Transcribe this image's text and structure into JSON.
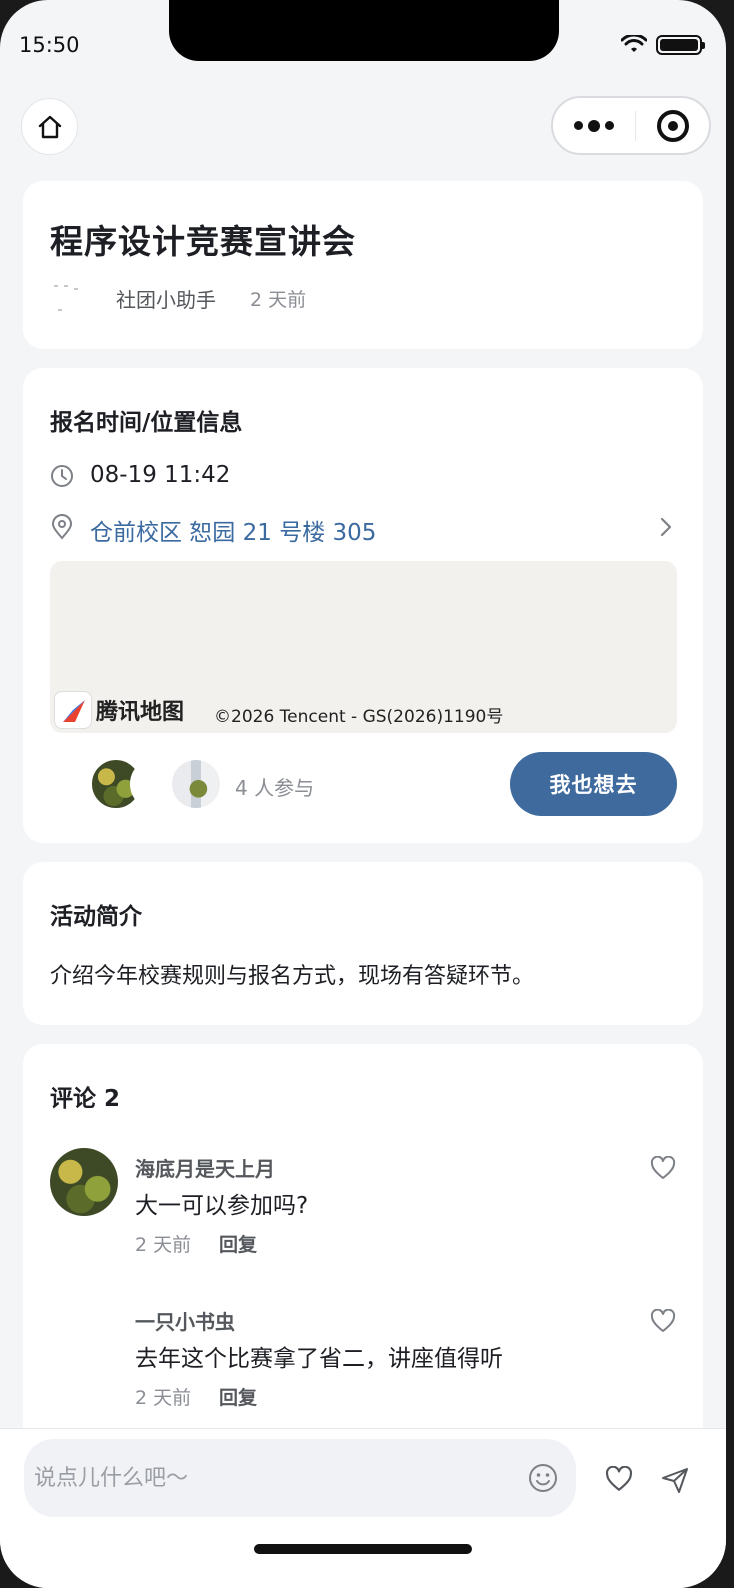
{
  "status_bar": {
    "time": "15:50"
  },
  "event": {
    "title": "程序设计竞赛宣讲会",
    "author": "社团小助手",
    "posted": "2 天前"
  },
  "info": {
    "section_title": "报名时间/位置信息",
    "time": "08-19 11:42",
    "location": "仓前校区 恕园 21 号楼 305",
    "map_logo": "腾讯地图",
    "map_copyright": "©2026 Tencent - GS(2026)1190号",
    "participants": "4 人参与",
    "join_button": "我也想去"
  },
  "intro": {
    "section_title": "活动简介",
    "text": "介绍今年校赛规则与报名方式，现场有答疑环节。"
  },
  "comments": {
    "section_title": "评论 2",
    "items": [
      {
        "name": "海底月是天上月",
        "text": "大一可以参加吗?",
        "time": "2 天前",
        "reply": "回复"
      },
      {
        "name": "一只小书虫",
        "text": "去年这个比赛拿了省二，讲座值得听",
        "time": "2 天前",
        "reply": "回复"
      }
    ]
  },
  "composer": {
    "placeholder": "说点儿什么吧～"
  },
  "icons": {
    "home": "home-icon",
    "more": "more-dots-icon",
    "close": "target-close-icon",
    "clock": "clock-icon",
    "location": "location-pin-icon",
    "chevron": "chevron-right-icon",
    "heart": "heart-icon",
    "emoji": "emoji-icon",
    "send": "send-icon"
  },
  "colors": {
    "accent": "#3e6a9e",
    "link": "#3b6aa0",
    "background": "#f4f5f7"
  }
}
